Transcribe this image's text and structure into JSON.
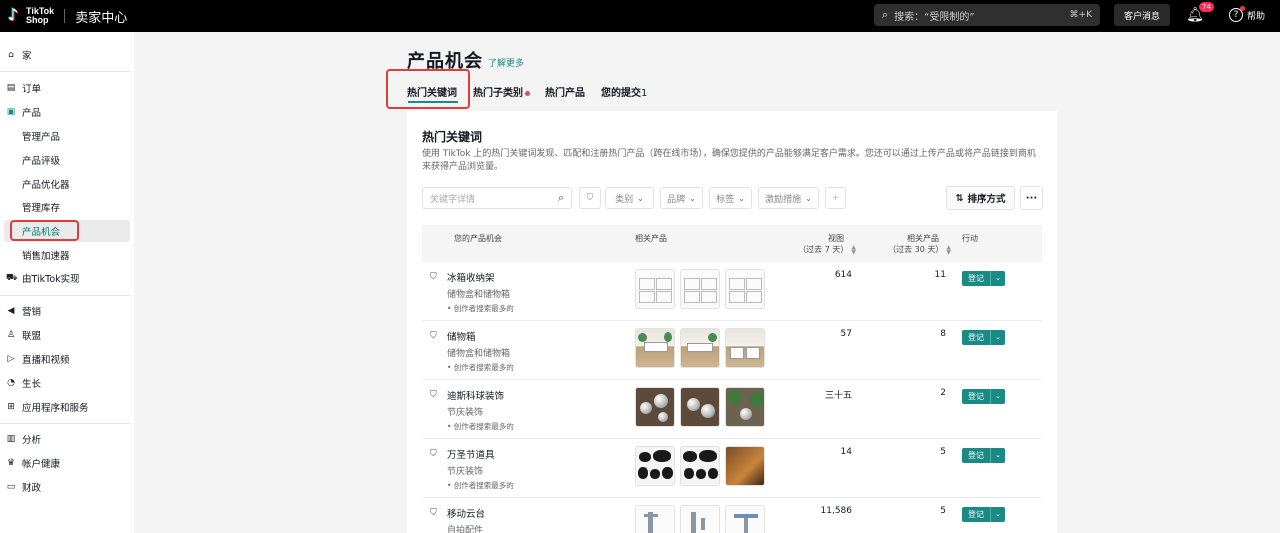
{
  "topbar": {
    "logo_line1": "TikTok",
    "logo_line2": "Shop",
    "center_name": "卖家中心",
    "search_text": "搜索：“受限制的”",
    "search_shortcut": "⌘+K",
    "customer_msg": "客户消息",
    "notif_count": "74",
    "help": "帮助"
  },
  "sidebar": {
    "home": "家",
    "orders": "订单",
    "products": "产品",
    "manage_products": "管理产品",
    "product_rating": "产品评级",
    "product_optimizer": "产品优化器",
    "manage_inventory": "管理库存",
    "product_opportunity": "产品机会",
    "sales_accelerator": "销售加速器",
    "tiktok_realize": "由TikTok实现",
    "marketing": "营销",
    "affiliate": "联盟",
    "live_video": "直播和视频",
    "growth": "生长",
    "apps_services": "应用程序和服务",
    "analytics": "分析",
    "account_health": "帐户健康",
    "finance": "财政"
  },
  "page": {
    "title": "产品机会",
    "learn_more": "了解更多",
    "tabs": {
      "hot_keywords": "热门关键词",
      "hot_subcategories": "热门子类别",
      "hot_products": "热门产品",
      "your_submissions": "您的提交",
      "submissions_count": "1"
    }
  },
  "card": {
    "title": "热门关键词",
    "desc": "使用 TikTok 上的热门关键词发现、匹配和注册热门产品（跨在线市场），确保您提供的产品能够满足客户需求。您还可以通过上传产品或将产品链接到商机来获得产品浏览量。",
    "keyword_placeholder": "关键字详情",
    "filter_category": "类别",
    "filter_brand": "品牌",
    "filter_tags": "标签",
    "filter_incentives": "激励措施",
    "sort": "排序方式",
    "more": "···"
  },
  "table": {
    "col_opportunity": "您的产品机会",
    "col_related_products": "相关产品",
    "col_views": "视图",
    "col_views_sub": "（过去 7 天）",
    "col_related_count": "相关产品",
    "col_related_count_sub": "（过去 30 天）",
    "col_action": "行动",
    "register_label": "登记",
    "rows": [
      {
        "name": "冰箱收纳架",
        "category": "储物盒和储物箱",
        "tag": "• 创作者搜索最多的",
        "views": "614",
        "related": "11"
      },
      {
        "name": "储物箱",
        "category": "储物盒和储物箱",
        "tag": "• 创作者搜索最多的",
        "views": "57",
        "related": "8"
      },
      {
        "name": "迪斯科球装饰",
        "category": "节庆装饰",
        "tag": "• 创作者搜索最多的",
        "views": "三十五",
        "related": "2"
      },
      {
        "name": "万圣节道具",
        "category": "节庆装饰",
        "tag": "• 创作者搜索最多的",
        "views": "14",
        "related": "5"
      },
      {
        "name": "移动云台",
        "category": "自拍配件",
        "tag": "",
        "views": "11,586",
        "related": "5"
      }
    ]
  },
  "colors": {
    "accent": "#1a8a84",
    "highlight_box": "#e03c3c",
    "notif_badge": "#fe2c55"
  }
}
